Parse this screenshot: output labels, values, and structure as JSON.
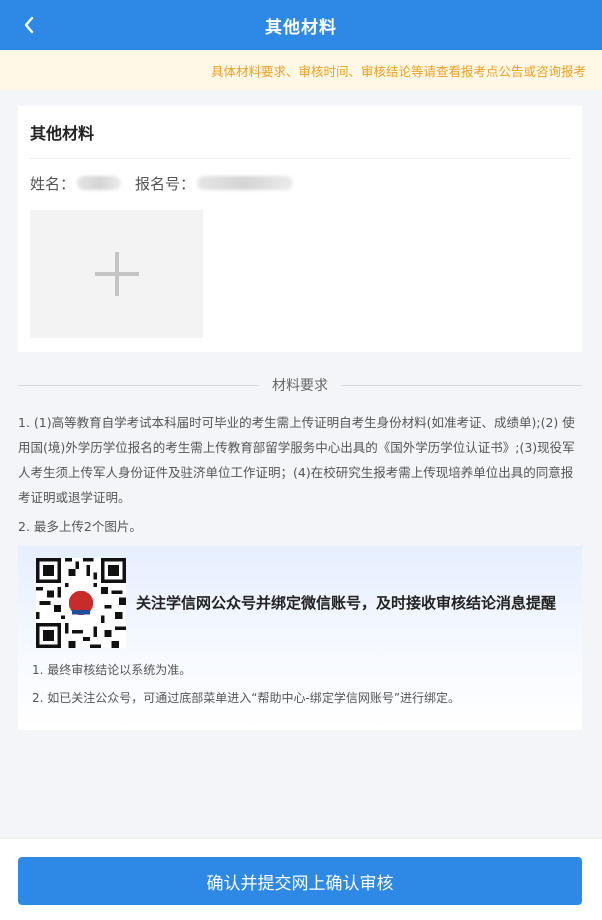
{
  "header": {
    "title": "其他材料",
    "back_icon": "chevron-left-icon"
  },
  "notice": {
    "text": "具体材料要求、审核时间、审核结论等请查看报考点公告或咨询报考"
  },
  "card": {
    "title": "其他材料",
    "name_label": "姓名：",
    "reg_label": "报名号：",
    "upload_icon": "plus-icon"
  },
  "requirements": {
    "heading": "材料要求",
    "items": [
      "1. (1)高等教育自学考试本科届时可毕业的考生需上传证明自考生身份材料(如准考证、成绩单);(2) 使用国(境)外学历学位报名的考生需上传教育部留学服务中心出具的《国外学历学位认证书》;(3)现役军人考生须上传军人身份证件及驻济单位工作证明；(4)在校研究生报考需上传现培养单位出具的同意报考证明或退学证明。",
      "2. 最多上传2个图片。"
    ]
  },
  "wechat": {
    "title": "关注学信网公众号并绑定微信账号，及时接收审核结论消息提醒",
    "notes": [
      "1. 最终审核结论以系统为准。",
      "2. 如已关注公众号，可通过底部菜单进入“帮助中心-绑定学信网账号”进行绑定。"
    ]
  },
  "footer": {
    "submit_label": "确认并提交网上确认审核"
  },
  "colors": {
    "primary": "#2e89e6",
    "notice_text": "#f0a020",
    "notice_bg": "#fff8e6"
  }
}
